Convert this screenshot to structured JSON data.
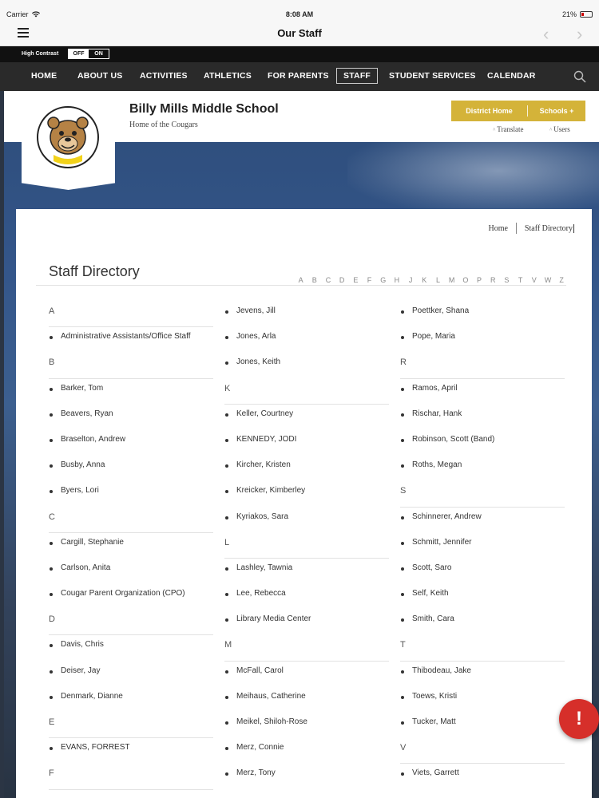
{
  "status_bar": {
    "carrier": "Carrier",
    "time": "8:08 AM",
    "battery": "21%"
  },
  "app_bar": {
    "title": "Our Staff"
  },
  "high_contrast": {
    "label": "High Contrast",
    "off": "OFF",
    "on": "ON"
  },
  "main_nav": {
    "items": [
      "HOME",
      "ABOUT US",
      "ACTIVITIES",
      "ATHLETICS",
      "FOR PARENTS",
      "STAFF",
      "STUDENT SERVICES",
      "CALENDAR"
    ],
    "active": "STAFF"
  },
  "school": {
    "name": "Billy Mills Middle School",
    "tagline": "Home of the Cougars"
  },
  "header_buttons": {
    "district_home": "District Home",
    "schools": "Schools  +",
    "translate": "Translate",
    "users": "Users"
  },
  "colors": {
    "accent_gold": "#d4b339",
    "nav_bg": "#2a2a2a",
    "alert_red": "#d62f2a"
  },
  "breadcrumb": {
    "home": "Home",
    "current": "Staff Directory"
  },
  "page": {
    "title": "Staff Directory"
  },
  "alphabet": [
    "A",
    "B",
    "C",
    "D",
    "E",
    "F",
    "G",
    "H",
    "J",
    "K",
    "L",
    "M",
    "O",
    "P",
    "R",
    "S",
    "T",
    "V",
    "W",
    "Z"
  ],
  "columns": [
    [
      {
        "t": "h",
        "v": "A"
      },
      {
        "t": "e",
        "v": "Administrative Assistants/Office Staff"
      },
      {
        "t": "h",
        "v": "B"
      },
      {
        "t": "e",
        "v": "Barker, Tom"
      },
      {
        "t": "e",
        "v": "Beavers, Ryan"
      },
      {
        "t": "e",
        "v": "Braselton, Andrew"
      },
      {
        "t": "e",
        "v": "Busby, Anna"
      },
      {
        "t": "e",
        "v": "Byers, Lori"
      },
      {
        "t": "h",
        "v": "C"
      },
      {
        "t": "e",
        "v": "Cargill, Stephanie"
      },
      {
        "t": "e",
        "v": "Carlson, Anita"
      },
      {
        "t": "e",
        "v": "Cougar Parent Organization (CPO)"
      },
      {
        "t": "h",
        "v": "D"
      },
      {
        "t": "e",
        "v": "Davis, Chris"
      },
      {
        "t": "e",
        "v": "Deiser, Jay"
      },
      {
        "t": "e",
        "v": "Denmark, Dianne"
      },
      {
        "t": "h",
        "v": "E"
      },
      {
        "t": "e",
        "v": "EVANS, FORREST"
      },
      {
        "t": "h",
        "v": "F"
      }
    ],
    [
      {
        "t": "e",
        "v": "Jevens, Jill"
      },
      {
        "t": "e",
        "v": "Jones, Arla"
      },
      {
        "t": "e",
        "v": "Jones, Keith"
      },
      {
        "t": "h",
        "v": "K"
      },
      {
        "t": "e",
        "v": "Keller, Courtney"
      },
      {
        "t": "e",
        "v": "KENNEDY, JODI"
      },
      {
        "t": "e",
        "v": "Kircher, Kristen"
      },
      {
        "t": "e",
        "v": "Kreicker, Kimberley"
      },
      {
        "t": "e",
        "v": "Kyriakos, Sara"
      },
      {
        "t": "h",
        "v": "L"
      },
      {
        "t": "e",
        "v": "Lashley, Tawnia"
      },
      {
        "t": "e",
        "v": "Lee, Rebecca"
      },
      {
        "t": "e",
        "v": "Library Media Center"
      },
      {
        "t": "h",
        "v": "M"
      },
      {
        "t": "e",
        "v": "McFall, Carol"
      },
      {
        "t": "e",
        "v": "Meihaus, Catherine"
      },
      {
        "t": "e",
        "v": "Meikel, Shiloh-Rose"
      },
      {
        "t": "e",
        "v": "Merz, Connie"
      },
      {
        "t": "e",
        "v": "Merz, Tony"
      }
    ],
    [
      {
        "t": "e",
        "v": "Poettker, Shana"
      },
      {
        "t": "e",
        "v": "Pope, Maria"
      },
      {
        "t": "h",
        "v": "R"
      },
      {
        "t": "e",
        "v": "Ramos, April"
      },
      {
        "t": "e",
        "v": "Rischar, Hank"
      },
      {
        "t": "e",
        "v": "Robinson, Scott (Band)"
      },
      {
        "t": "e",
        "v": "Roths, Megan"
      },
      {
        "t": "h",
        "v": "S"
      },
      {
        "t": "e",
        "v": "Schinnerer, Andrew"
      },
      {
        "t": "e",
        "v": "Schmitt, Jennifer"
      },
      {
        "t": "e",
        "v": "Scott, Saro"
      },
      {
        "t": "e",
        "v": "Self, Keith"
      },
      {
        "t": "e",
        "v": "Smith, Cara"
      },
      {
        "t": "h",
        "v": "T"
      },
      {
        "t": "e",
        "v": "Thibodeau, Jake"
      },
      {
        "t": "e",
        "v": "Toews, Kristi"
      },
      {
        "t": "e",
        "v": "Tucker, Matt"
      },
      {
        "t": "h",
        "v": "V"
      },
      {
        "t": "e",
        "v": "Viets, Garrett"
      }
    ]
  ],
  "alert": {
    "label": "!"
  }
}
